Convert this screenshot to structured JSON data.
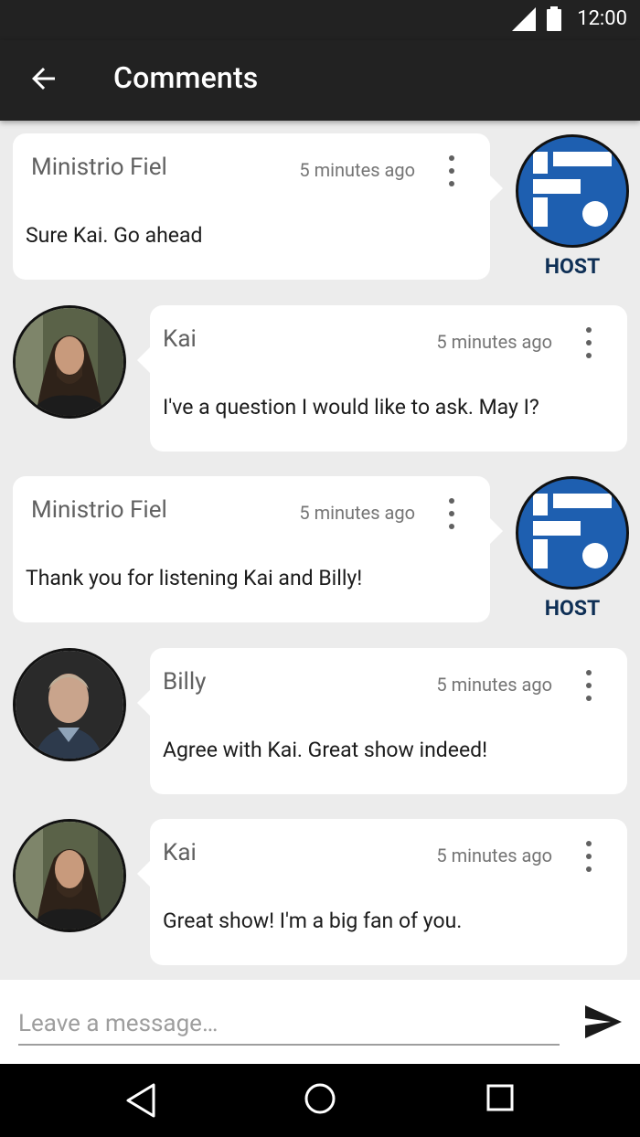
{
  "status_bar": {
    "time": "12:00"
  },
  "app_bar": {
    "title": "Comments"
  },
  "comments": [
    {
      "author": "Ministrio Fiel",
      "time": "5 minutes ago",
      "message": "Sure Kai. Go ahead",
      "is_host": true,
      "badge": "HOST"
    },
    {
      "author": "Kai",
      "time": "5 minutes ago",
      "message": "I've a question I would like to ask. May I?",
      "is_host": false
    },
    {
      "author": "Ministrio Fiel",
      "time": "5 minutes ago",
      "message": "Thank you for listening Kai and Billy!",
      "is_host": true,
      "badge": "HOST"
    },
    {
      "author": "Billy",
      "time": "5 minutes ago",
      "message": "Agree with Kai. Great show indeed!",
      "is_host": false
    },
    {
      "author": "Kai",
      "time": "5 minutes ago",
      "message": "Great show! I'm a big fan of you.",
      "is_host": false
    }
  ],
  "composer": {
    "placeholder": "Leave a message…"
  },
  "colors": {
    "bar": "#222222",
    "host_blue": "#1e5fb0",
    "host_label": "#0e2f55",
    "background": "#ececec"
  }
}
